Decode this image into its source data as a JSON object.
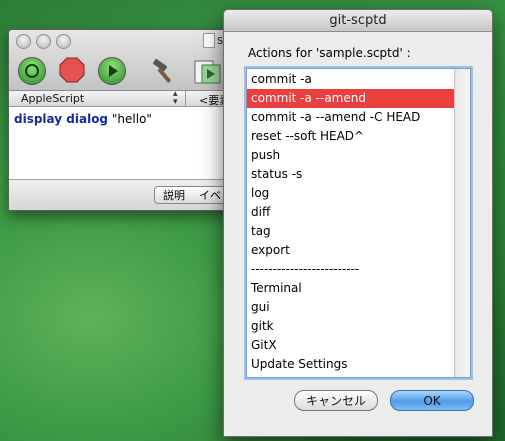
{
  "editor": {
    "title_fragment": "s",
    "language": "AppleScript",
    "element_label": "<要素",
    "code_keyword": "display dialog",
    "code_string": "\"hello\"",
    "tab_description": "説明",
    "tab_event": "イベ"
  },
  "dialog": {
    "title": "git-scptd",
    "prompt": "Actions for 'sample.scptd' :",
    "items": [
      "commit -a",
      "commit -a --amend",
      "commit -a --amend -C HEAD",
      "reset --soft HEAD^",
      "push",
      "status -s",
      "log",
      "diff",
      "tag",
      "export",
      "-------------------------",
      "Terminal",
      "gui",
      "gitk",
      "GitX",
      "Update Settings"
    ],
    "selected_index": 1,
    "cancel_label": "キャンセル",
    "ok_label": "OK"
  },
  "colors": {
    "selection": "#e9403f",
    "ok_button": "#4f9de8",
    "desktop": "#3c9b46"
  }
}
